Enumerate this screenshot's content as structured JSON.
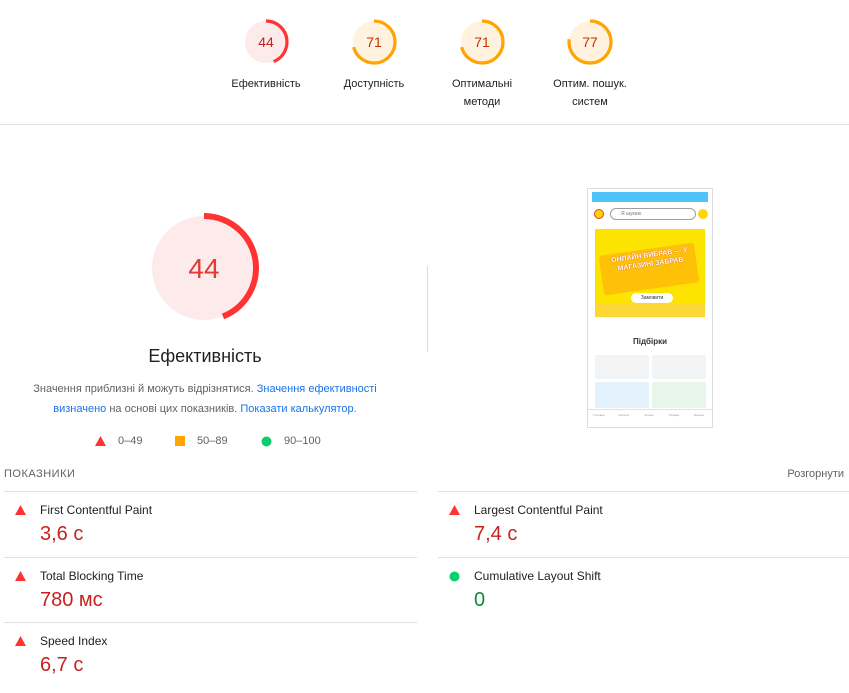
{
  "top_gauges": [
    {
      "score": "44",
      "label_lines": [
        "Ефективність"
      ],
      "color": "#ff3333",
      "ring_fill": 0.44,
      "bg": "#fdeaea"
    },
    {
      "score": "71",
      "label_lines": [
        "Доступність"
      ],
      "color": "#ffa400",
      "ring_fill": 0.71,
      "bg": "#fff3e0"
    },
    {
      "score": "71",
      "label_lines": [
        "Оптимальні",
        "методи"
      ],
      "color": "#ffa400",
      "ring_fill": 0.71,
      "bg": "#fff3e0"
    },
    {
      "score": "77",
      "label_lines": [
        "Оптим. пошук.",
        "систем"
      ],
      "color": "#ffa400",
      "ring_fill": 0.77,
      "bg": "#fff3e0"
    }
  ],
  "main_gauge": {
    "score": "44",
    "title": "Ефективність",
    "color": "#ff3333",
    "bg": "#fdeaea",
    "ring_fill": 0.44
  },
  "note": {
    "text1": "Значення приблизні й можуть відрізнятися.",
    "link1": "Значення ефективності визначено",
    "text2": "на основі цих показників.",
    "link2": "Показати калькулятор",
    "end": "."
  },
  "legend": [
    {
      "range": "0–49",
      "shape": "triangle",
      "color": "#ff3333"
    },
    {
      "range": "50–89",
      "shape": "square",
      "color": "#ffa400"
    },
    {
      "range": "90–100",
      "shape": "circle",
      "color": "#0cce6b"
    }
  ],
  "screenshot": {
    "search_placeholder": "Я шукаю",
    "promo_text": "ОНЛАЙН ВИБРАВ — У МАГАЗИНІ ЗАБРАВ",
    "promo_button": "Замовити",
    "section_title": "Підбірки",
    "nav": [
      "Головна",
      "Каталог",
      "Кошик",
      "Обране",
      "Більше"
    ]
  },
  "metrics": {
    "heading": "ПОКАЗНИКИ",
    "expand_label": "Розгорнути",
    "items": [
      {
        "name": "First Contentful Paint",
        "value": "3,6 с",
        "status": "bad"
      },
      {
        "name": "Largest Contentful Paint",
        "value": "7,4 с",
        "status": "bad"
      },
      {
        "name": "Total Blocking Time",
        "value": "780 мс",
        "status": "bad"
      },
      {
        "name": "Cumulative Layout Shift",
        "value": "0",
        "status": "good"
      },
      {
        "name": "Speed Index",
        "value": "6,7 с",
        "status": "bad"
      }
    ]
  }
}
